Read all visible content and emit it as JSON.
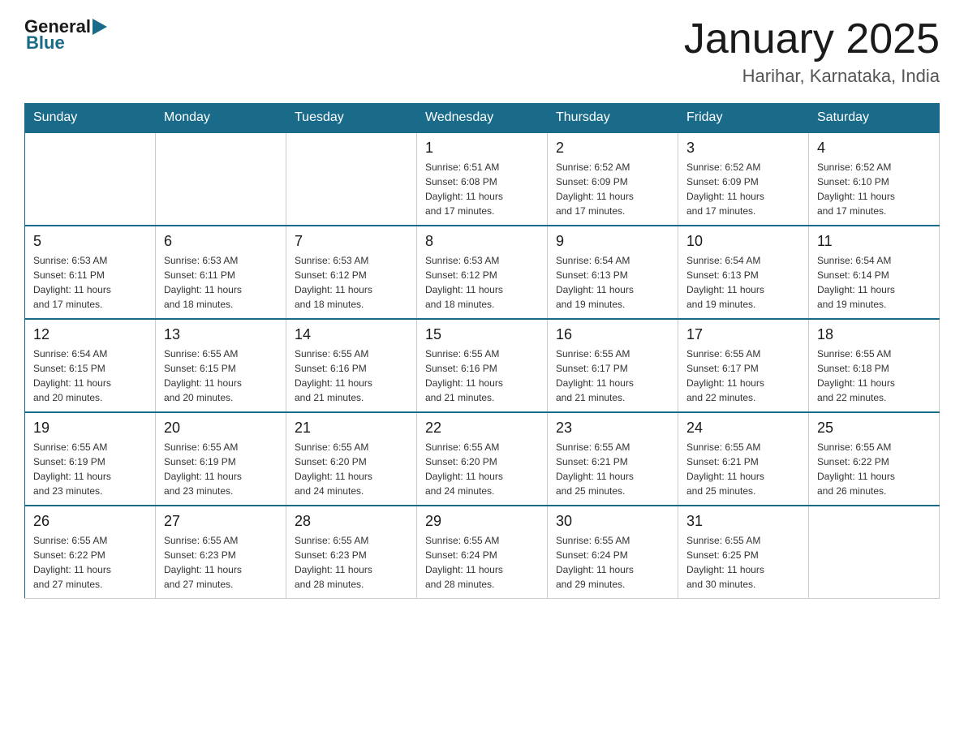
{
  "header": {
    "logo": {
      "text_general": "General",
      "text_blue": "Blue"
    },
    "title": "January 2025",
    "subtitle": "Harihar, Karnataka, India"
  },
  "days_of_week": [
    "Sunday",
    "Monday",
    "Tuesday",
    "Wednesday",
    "Thursday",
    "Friday",
    "Saturday"
  ],
  "weeks": [
    {
      "days": [
        {
          "number": "",
          "info": ""
        },
        {
          "number": "",
          "info": ""
        },
        {
          "number": "",
          "info": ""
        },
        {
          "number": "1",
          "info": "Sunrise: 6:51 AM\nSunset: 6:08 PM\nDaylight: 11 hours\nand 17 minutes."
        },
        {
          "number": "2",
          "info": "Sunrise: 6:52 AM\nSunset: 6:09 PM\nDaylight: 11 hours\nand 17 minutes."
        },
        {
          "number": "3",
          "info": "Sunrise: 6:52 AM\nSunset: 6:09 PM\nDaylight: 11 hours\nand 17 minutes."
        },
        {
          "number": "4",
          "info": "Sunrise: 6:52 AM\nSunset: 6:10 PM\nDaylight: 11 hours\nand 17 minutes."
        }
      ]
    },
    {
      "days": [
        {
          "number": "5",
          "info": "Sunrise: 6:53 AM\nSunset: 6:11 PM\nDaylight: 11 hours\nand 17 minutes."
        },
        {
          "number": "6",
          "info": "Sunrise: 6:53 AM\nSunset: 6:11 PM\nDaylight: 11 hours\nand 18 minutes."
        },
        {
          "number": "7",
          "info": "Sunrise: 6:53 AM\nSunset: 6:12 PM\nDaylight: 11 hours\nand 18 minutes."
        },
        {
          "number": "8",
          "info": "Sunrise: 6:53 AM\nSunset: 6:12 PM\nDaylight: 11 hours\nand 18 minutes."
        },
        {
          "number": "9",
          "info": "Sunrise: 6:54 AM\nSunset: 6:13 PM\nDaylight: 11 hours\nand 19 minutes."
        },
        {
          "number": "10",
          "info": "Sunrise: 6:54 AM\nSunset: 6:13 PM\nDaylight: 11 hours\nand 19 minutes."
        },
        {
          "number": "11",
          "info": "Sunrise: 6:54 AM\nSunset: 6:14 PM\nDaylight: 11 hours\nand 19 minutes."
        }
      ]
    },
    {
      "days": [
        {
          "number": "12",
          "info": "Sunrise: 6:54 AM\nSunset: 6:15 PM\nDaylight: 11 hours\nand 20 minutes."
        },
        {
          "number": "13",
          "info": "Sunrise: 6:55 AM\nSunset: 6:15 PM\nDaylight: 11 hours\nand 20 minutes."
        },
        {
          "number": "14",
          "info": "Sunrise: 6:55 AM\nSunset: 6:16 PM\nDaylight: 11 hours\nand 21 minutes."
        },
        {
          "number": "15",
          "info": "Sunrise: 6:55 AM\nSunset: 6:16 PM\nDaylight: 11 hours\nand 21 minutes."
        },
        {
          "number": "16",
          "info": "Sunrise: 6:55 AM\nSunset: 6:17 PM\nDaylight: 11 hours\nand 21 minutes."
        },
        {
          "number": "17",
          "info": "Sunrise: 6:55 AM\nSunset: 6:17 PM\nDaylight: 11 hours\nand 22 minutes."
        },
        {
          "number": "18",
          "info": "Sunrise: 6:55 AM\nSunset: 6:18 PM\nDaylight: 11 hours\nand 22 minutes."
        }
      ]
    },
    {
      "days": [
        {
          "number": "19",
          "info": "Sunrise: 6:55 AM\nSunset: 6:19 PM\nDaylight: 11 hours\nand 23 minutes."
        },
        {
          "number": "20",
          "info": "Sunrise: 6:55 AM\nSunset: 6:19 PM\nDaylight: 11 hours\nand 23 minutes."
        },
        {
          "number": "21",
          "info": "Sunrise: 6:55 AM\nSunset: 6:20 PM\nDaylight: 11 hours\nand 24 minutes."
        },
        {
          "number": "22",
          "info": "Sunrise: 6:55 AM\nSunset: 6:20 PM\nDaylight: 11 hours\nand 24 minutes."
        },
        {
          "number": "23",
          "info": "Sunrise: 6:55 AM\nSunset: 6:21 PM\nDaylight: 11 hours\nand 25 minutes."
        },
        {
          "number": "24",
          "info": "Sunrise: 6:55 AM\nSunset: 6:21 PM\nDaylight: 11 hours\nand 25 minutes."
        },
        {
          "number": "25",
          "info": "Sunrise: 6:55 AM\nSunset: 6:22 PM\nDaylight: 11 hours\nand 26 minutes."
        }
      ]
    },
    {
      "days": [
        {
          "number": "26",
          "info": "Sunrise: 6:55 AM\nSunset: 6:22 PM\nDaylight: 11 hours\nand 27 minutes."
        },
        {
          "number": "27",
          "info": "Sunrise: 6:55 AM\nSunset: 6:23 PM\nDaylight: 11 hours\nand 27 minutes."
        },
        {
          "number": "28",
          "info": "Sunrise: 6:55 AM\nSunset: 6:23 PM\nDaylight: 11 hours\nand 28 minutes."
        },
        {
          "number": "29",
          "info": "Sunrise: 6:55 AM\nSunset: 6:24 PM\nDaylight: 11 hours\nand 28 minutes."
        },
        {
          "number": "30",
          "info": "Sunrise: 6:55 AM\nSunset: 6:24 PM\nDaylight: 11 hours\nand 29 minutes."
        },
        {
          "number": "31",
          "info": "Sunrise: 6:55 AM\nSunset: 6:25 PM\nDaylight: 11 hours\nand 30 minutes."
        },
        {
          "number": "",
          "info": ""
        }
      ]
    }
  ]
}
